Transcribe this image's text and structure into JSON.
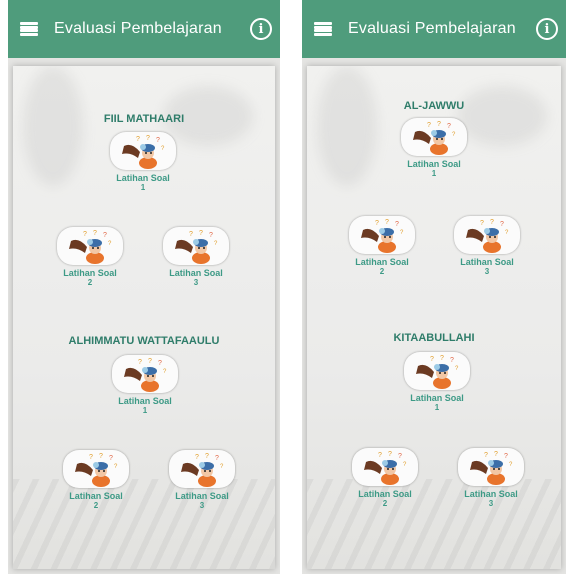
{
  "app_title": "Evaluasi Pembelajaran",
  "info_glyph": "i",
  "left": {
    "sections": [
      {
        "title": "FIIL MATHAARI",
        "items": [
          {
            "label": "Latihan Soal",
            "number": "1"
          },
          {
            "label": "Latihan Soal",
            "number": "2"
          },
          {
            "label": "Latihan Soal",
            "number": "3"
          }
        ]
      },
      {
        "title": "ALHIMMATU WATTAFAAULU",
        "items": [
          {
            "label": "Latihan Soal",
            "number": "1"
          },
          {
            "label": "Latihan Soal",
            "number": "2"
          },
          {
            "label": "Latihan Soal",
            "number": "3"
          }
        ]
      }
    ]
  },
  "right": {
    "sections": [
      {
        "title": "AL-JAWWU",
        "items": [
          {
            "label": "Latihan Soal",
            "number": "1"
          },
          {
            "label": "Latihan Soal",
            "number": "2"
          },
          {
            "label": "Latihan Soal",
            "number": "3"
          }
        ]
      },
      {
        "title": "KITAABULLAHI",
        "items": [
          {
            "label": "Latihan Soal",
            "number": "1"
          },
          {
            "label": "Latihan Soal",
            "number": "2"
          },
          {
            "label": "Latihan Soal",
            "number": "3"
          }
        ]
      }
    ]
  },
  "colors": {
    "appbar": "#4f9c7c",
    "section_title": "#2f7d6a",
    "item_label": "#3d9a86"
  },
  "icons": {
    "menu": "menu-icon",
    "info": "info-icon",
    "thumbnail": "confused-student-icon"
  }
}
